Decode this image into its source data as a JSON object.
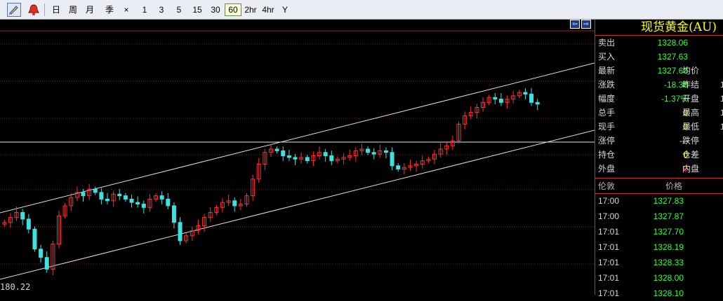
{
  "toolbar": {
    "periods": [
      {
        "label": "日",
        "active": false
      },
      {
        "label": "周",
        "active": false
      },
      {
        "label": "月",
        "active": false
      },
      {
        "label": "季",
        "active": false
      },
      {
        "label": "×",
        "active": false
      },
      {
        "label": "1",
        "active": false
      },
      {
        "label": "3",
        "active": false
      },
      {
        "label": "5",
        "active": false
      },
      {
        "label": "15",
        "active": false
      },
      {
        "label": "30",
        "active": false
      },
      {
        "label": "60",
        "active": true
      },
      {
        "label": "2hr",
        "active": false
      },
      {
        "label": "4hr",
        "active": false
      },
      {
        "label": "Y",
        "active": false
      }
    ],
    "icons": [
      "draw-tool-icon",
      "alarm-bell-icon"
    ]
  },
  "chart": {
    "low_price_label": "180.22",
    "nav_buttons": [
      "⇦",
      "⇨"
    ],
    "colors": {
      "up": "#ff3030",
      "down": "#40e0e0",
      "grid": "#8b1a1a",
      "channel": "#e0e0e0"
    }
  },
  "chart_data": {
    "type": "candlestick",
    "title": "",
    "low_label": "180.22",
    "closes": [
      1305.0,
      1306.5,
      1308.0,
      1306.0,
      1303.0,
      1297.0,
      1294.5,
      1291.0,
      1298.5,
      1307.0,
      1310.0,
      1312.5,
      1314.0,
      1313.0,
      1315.0,
      1314.0,
      1312.0,
      1311.5,
      1313.5,
      1313.0,
      1312.0,
      1311.0,
      1310.5,
      1309.5,
      1312.0,
      1313.0,
      1312.0,
      1310.0,
      1305.0,
      1299.5,
      1301.0,
      1302.5,
      1304.0,
      1306.5,
      1308.0,
      1309.5,
      1311.0,
      1311.5,
      1310.0,
      1310.5,
      1313.0,
      1318.0,
      1322.5,
      1326.0,
      1327.0,
      1326.5,
      1325.0,
      1324.5,
      1324.0,
      1324.5,
      1323.5,
      1325.0,
      1326.0,
      1325.0,
      1323.5,
      1324.0,
      1324.5,
      1325.0,
      1326.5,
      1327.0,
      1326.0,
      1325.5,
      1326.5,
      1326.0,
      1322.0,
      1321.0,
      1321.5,
      1322.0,
      1322.5,
      1323.5,
      1324.0,
      1325.5,
      1327.0,
      1328.0,
      1329.5,
      1334.5,
      1337.0,
      1338.0,
      1339.5,
      1341.0,
      1342.5,
      1342.0,
      1341.0,
      1342.0,
      1343.0,
      1344.0,
      1343.5,
      1341.0,
      1340.5
    ]
  },
  "panel": {
    "title": "现货黄金(AU)",
    "quotes": [
      {
        "label": "卖出",
        "value": "1328.06",
        "color": "green",
        "label2": "",
        "tick": ""
      },
      {
        "label": "买入",
        "value": "1327.63",
        "color": "green",
        "label2": "",
        "tick": ""
      },
      {
        "label": "最新",
        "value": "1327.63",
        "color": "green",
        "label2": "均价",
        "tick": ""
      },
      {
        "label": "涨跌",
        "value": "-18.38",
        "color": "green",
        "label2": "昨结",
        "tick": "1"
      },
      {
        "label": "幅度",
        "value": "-1.37%",
        "color": "green",
        "label2": "开盘",
        "tick": "1"
      },
      {
        "label": "总手",
        "value": "0",
        "color": "yellow",
        "label2": "最高",
        "tick": "1"
      },
      {
        "label": "现手",
        "value": "0",
        "color": "yellow",
        "label2": "最低",
        "tick": "1"
      },
      {
        "label": "涨停",
        "value": "---",
        "color": "white",
        "label2": "跌停",
        "tick": ""
      },
      {
        "label": "持仓",
        "value": "0",
        "color": "yellow",
        "label2": "仓差",
        "tick": ""
      },
      {
        "label": "外盘",
        "value": "0",
        "color": "red",
        "label2": "内盘",
        "tick": ""
      }
    ],
    "ticks_header": {
      "time": "伦敦",
      "price": "价格"
    },
    "ticks": [
      {
        "time": "17:00",
        "price": "1327.83"
      },
      {
        "time": "17:00",
        "price": "1327.87"
      },
      {
        "time": "17:01",
        "price": "1327.70"
      },
      {
        "time": "17:01",
        "price": "1328.19"
      },
      {
        "time": "17:01",
        "price": "1328.33"
      },
      {
        "time": "17:01",
        "price": "1328.00"
      },
      {
        "time": "17:01",
        "price": "1328.10"
      }
    ]
  }
}
